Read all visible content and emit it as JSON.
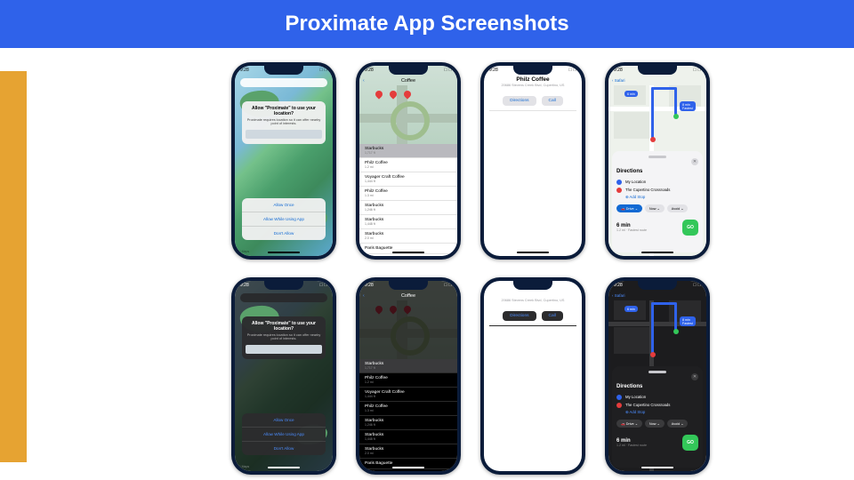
{
  "slide": {
    "title": "Proximate App Screenshots"
  },
  "status": {
    "time": "9:28",
    "indicators": "􀙇 􀛨"
  },
  "s1": {
    "alert_title": "Allow \"Proximate\" to use your location?",
    "alert_body": "Proximate requires location so it can offer nearby point of interests.",
    "opt_once": "Allow Once",
    "opt_while": "Allow While Using App",
    "opt_deny": "Don't Allow",
    "maps_label": "􀣩 Maps"
  },
  "s2": {
    "back": "‹",
    "title": "Coffee",
    "results": [
      {
        "name": "Starbucks",
        "dist": "1,717 ft"
      },
      {
        "name": "Philz Coffee",
        "dist": "1.2 mi"
      },
      {
        "name": "Voyager Craft Coffee",
        "dist": "1,444 ft"
      },
      {
        "name": "Philz Coffee",
        "dist": "1.3 mi"
      },
      {
        "name": "Starbucks",
        "dist": "1,246 ft"
      },
      {
        "name": "Starbucks",
        "dist": "1,448 ft"
      },
      {
        "name": "Starbucks",
        "dist": "2.0 mi"
      },
      {
        "name": "Paris Baguette",
        "dist": ""
      }
    ]
  },
  "s3": {
    "title": "Philz Coffee",
    "subtitle": "20686 Stevens Creek Blvd, Cupertino, US",
    "btn_directions": "Directions",
    "btn_call": "Call"
  },
  "s4": {
    "nav_back": "‹ Safari",
    "route_bubble_1": "6 min",
    "route_bubble_2": "8 min\nFastest",
    "card_title": "Directions",
    "close": "✕",
    "wp_from": "My Location",
    "wp_to": "The Cupertino Crossroads",
    "add_stop": "Add Stop",
    "mode_drive": "🚗 Drive ⌄",
    "mode_now": "Now ⌄",
    "mode_avoid": "Avoid ⌄",
    "eta": "6 min",
    "eta_sub": "1.2 mi · Fastest route",
    "go": "GO"
  }
}
